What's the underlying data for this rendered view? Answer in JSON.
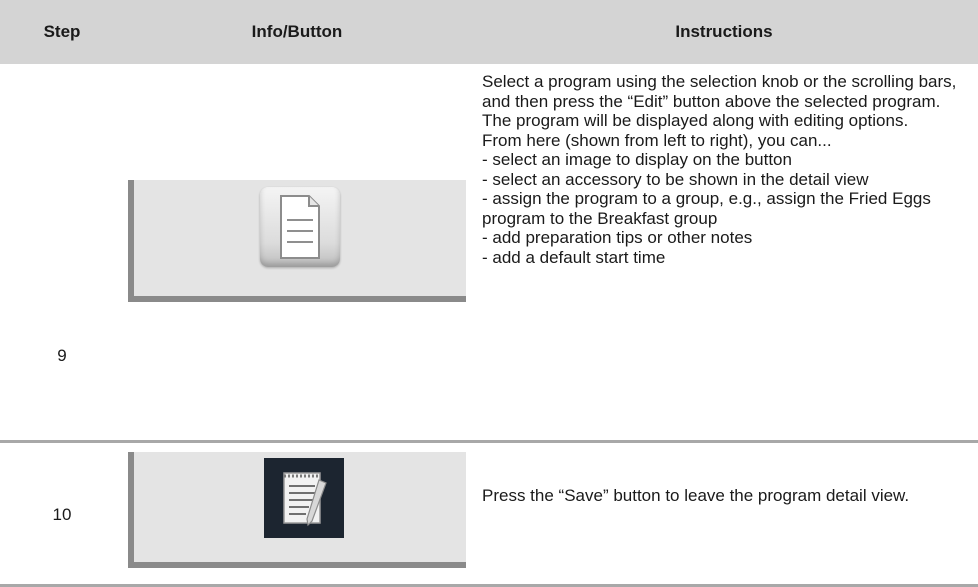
{
  "table": {
    "headers": {
      "step": "Step",
      "info": "Info/Button",
      "instructions": "Instructions"
    },
    "rows": [
      {
        "step": "9",
        "icon": "document-icon",
        "instructions": [
          "Select a program using the selection knob or the scrolling bars, and then press the “Edit” button above the selected program.",
          "The program will be displayed along with editing options.",
          "From here (shown from left to right), you can...",
          "- select an image to display on the button",
          "- select an accessory to be shown in the detail view",
          "- assign the program to a group, e.g., assign the Fried Eggs program to the Breakfast group",
          "- add preparation tips or other notes",
          "- add a default start time"
        ]
      },
      {
        "step": "10",
        "icon": "notepad-save-icon",
        "instructions": [
          "Press the “Save” button to leave the program detail view."
        ]
      }
    ]
  }
}
